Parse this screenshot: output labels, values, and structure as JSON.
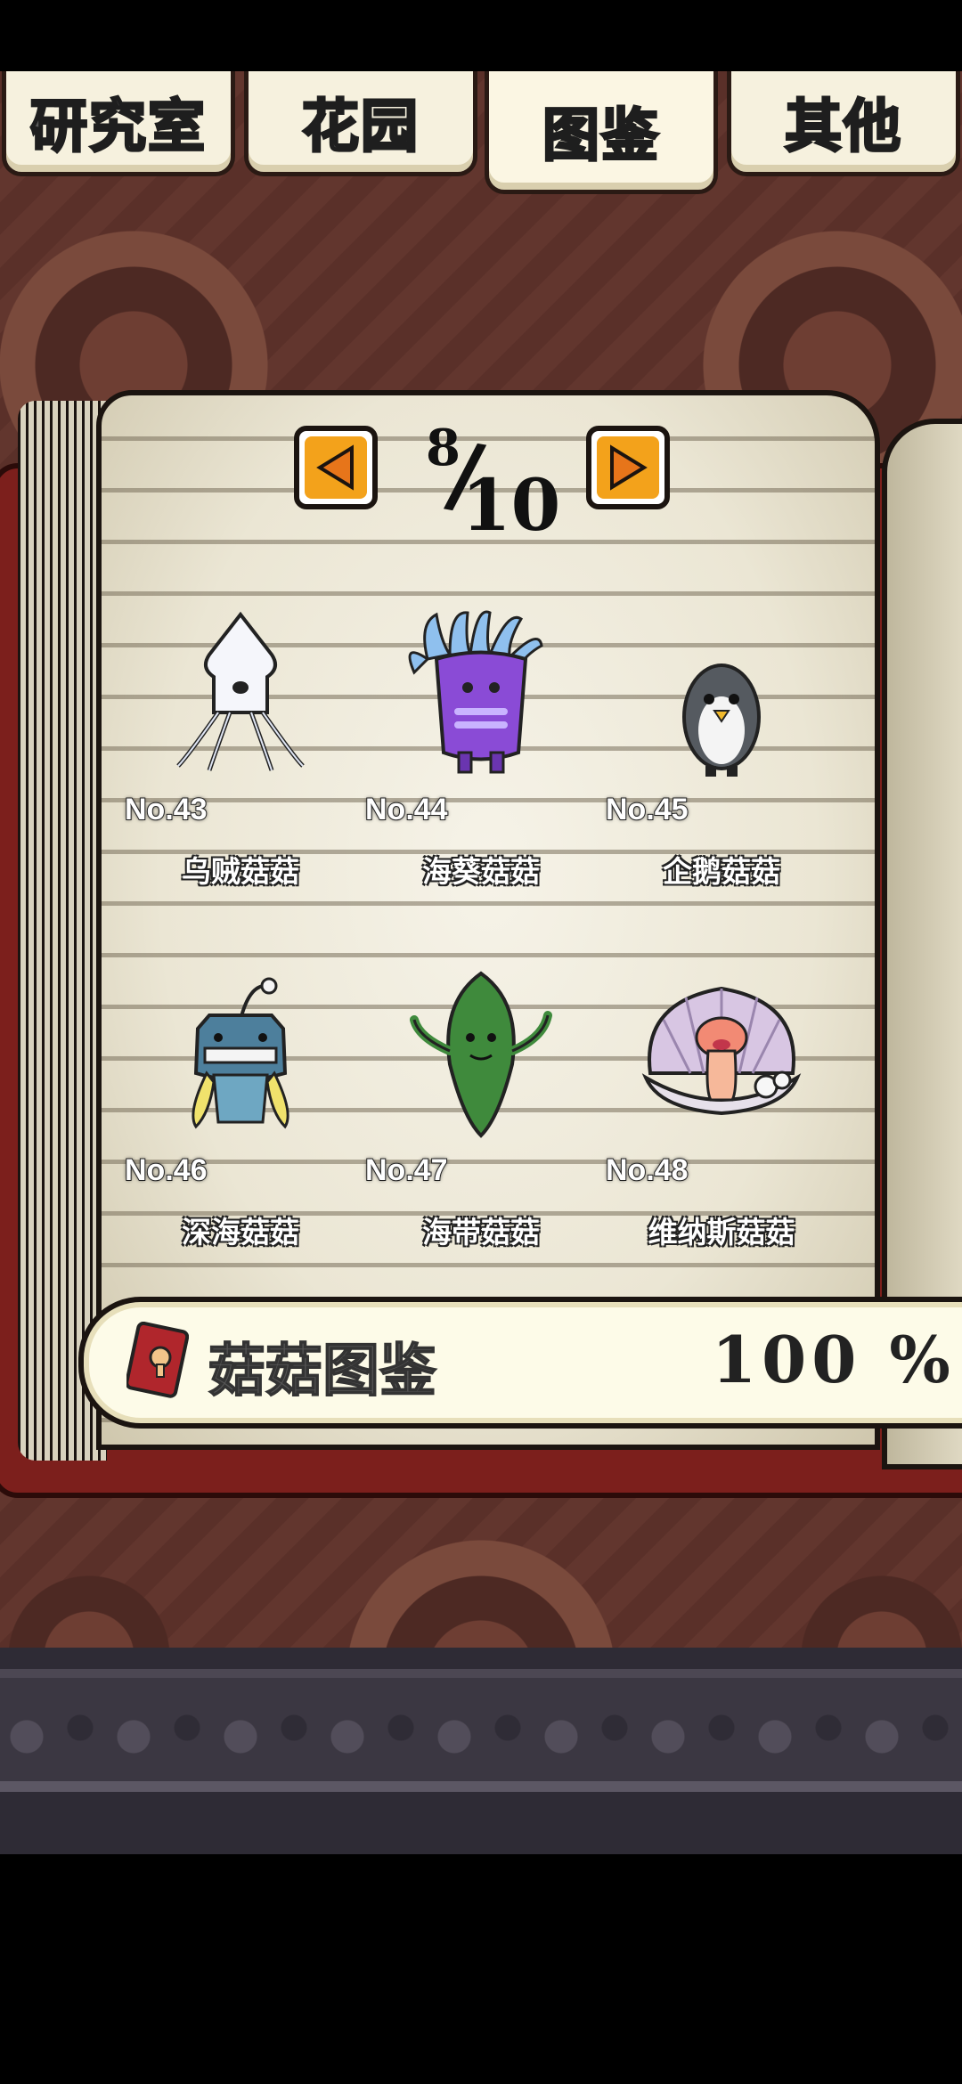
{
  "tabs": [
    {
      "label": "研究室",
      "active": false
    },
    {
      "label": "花园",
      "active": false
    },
    {
      "label": "图鉴",
      "active": true
    },
    {
      "label": "其他",
      "active": false
    }
  ],
  "pager": {
    "current": "8",
    "total": "10"
  },
  "entries": [
    {
      "no": "No.43",
      "name": "乌贼菇菇",
      "icon": "squid-mushroom-icon"
    },
    {
      "no": "No.44",
      "name": "海葵菇菇",
      "icon": "sea-anemone-mushroom-icon"
    },
    {
      "no": "No.45",
      "name": "企鹅菇菇",
      "icon": "penguin-mushroom-icon"
    },
    {
      "no": "No.46",
      "name": "深海菇菇",
      "icon": "deep-sea-mushroom-icon"
    },
    {
      "no": "No.47",
      "name": "海带菇菇",
      "icon": "kelp-mushroom-icon"
    },
    {
      "no": "No.48",
      "name": "维纳斯菇菇",
      "icon": "venus-shell-mushroom-icon"
    }
  ],
  "summary": {
    "title": "菇菇图鉴",
    "percent": "100 %"
  },
  "colors": {
    "accent": "#f3a21b",
    "activeTab": "#ffd21c",
    "bookCover": "#7c1f1c"
  }
}
